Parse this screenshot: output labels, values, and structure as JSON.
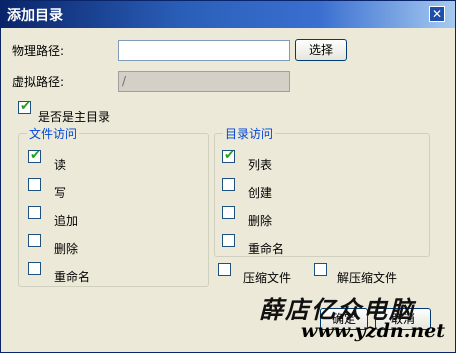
{
  "window": {
    "title": "添加目录",
    "close_glyph": "✕"
  },
  "form": {
    "physical_path_label": "物理路径:",
    "physical_path_value": "",
    "browse_button": "选择",
    "virtual_path_label": "虚拟路径:",
    "virtual_path_value": "/",
    "is_main_dir_label": "是否是主目录",
    "is_main_dir_checked": true
  },
  "file_access": {
    "legend": "文件访问",
    "items": [
      {
        "label": "读",
        "checked": true
      },
      {
        "label": "写",
        "checked": false
      },
      {
        "label": "追加",
        "checked": false
      },
      {
        "label": "删除",
        "checked": false
      },
      {
        "label": "重命名",
        "checked": false
      }
    ]
  },
  "dir_access": {
    "legend": "目录访问",
    "items": [
      {
        "label": "列表",
        "checked": true
      },
      {
        "label": "创建",
        "checked": false
      },
      {
        "label": "删除",
        "checked": false
      },
      {
        "label": "重命名",
        "checked": false
      }
    ]
  },
  "compress": {
    "label": "压缩文件",
    "checked": false
  },
  "decompress": {
    "label": "解压缩文件",
    "checked": false
  },
  "footer": {
    "ok_button": "确定",
    "cancel_button": "取消"
  },
  "watermark": {
    "line1": "薛店亿众电脑",
    "line2": "www.yzdn.net"
  }
}
